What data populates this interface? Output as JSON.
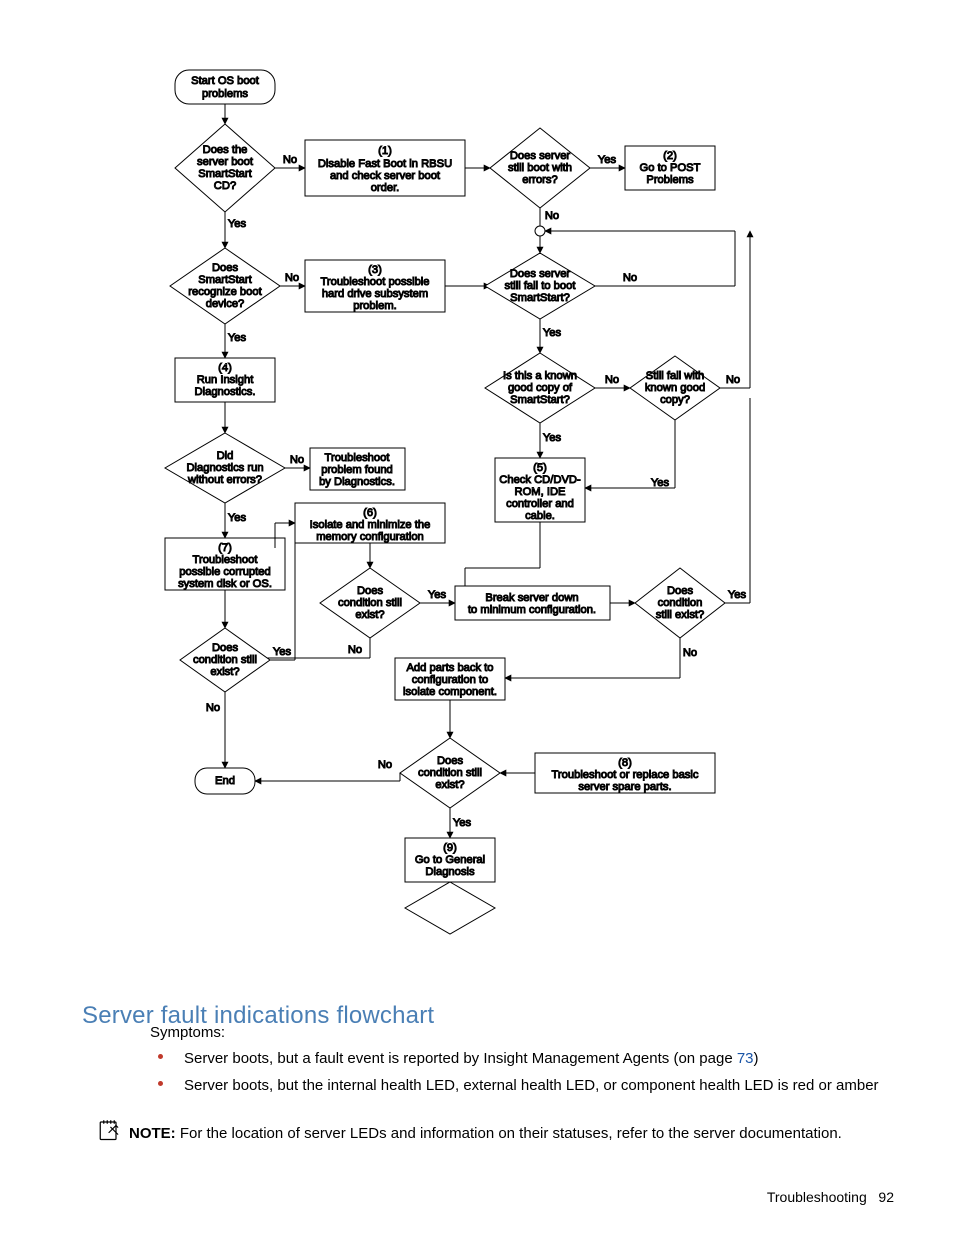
{
  "heading": "Server fault indications flowchart",
  "symptoms_label": "Symptoms:",
  "bullets": [
    {
      "pre": "Server boots, but a fault event is reported by Insight Management Agents (on page ",
      "link": "73",
      "post": ")"
    },
    {
      "pre": "Server boots, but the internal health LED, external health LED, or component health LED is red or amber",
      "link": "",
      "post": ""
    }
  ],
  "note_label": "NOTE:",
  "note_text": "  For the location of server LEDs and information on their statuses, refer to the server documentation.",
  "footer_label": "Troubleshooting",
  "footer_page": "92",
  "flow": {
    "start": [
      "Start OS boot",
      "problems"
    ],
    "d_boot_cd": [
      "Does the",
      "server boot",
      "SmartStart",
      "CD?"
    ],
    "p1": [
      "(1)",
      "Disable Fast Boot in RBSU",
      "and check server boot",
      "order."
    ],
    "d_errors": [
      "Does server",
      "still boot with",
      "errors?"
    ],
    "p2": [
      "(2)",
      "Go to POST",
      "Problems"
    ],
    "d_recognize": [
      "Does",
      "SmartStart",
      "recognize boot",
      "device?"
    ],
    "p3": [
      "(3)",
      "Troubleshoot possible",
      "hard drive subsystem",
      "problem."
    ],
    "d_still_fail": [
      "Does server",
      "still fail to boot",
      "SmartStart?"
    ],
    "p4": [
      "(4)",
      "Run Insight",
      "Diagnostics."
    ],
    "d_known_good": [
      "Is this a known",
      "good copy of",
      "SmartStart?"
    ],
    "d_known_copy": [
      "Still fail with",
      "known good",
      "copy?"
    ],
    "d_diag_err": [
      "Did",
      "Diagnostics run",
      "without errors?"
    ],
    "p_diag_found": [
      "Troubleshoot",
      "problem found",
      "by Diagnostics."
    ],
    "p5": [
      "(5)",
      "Check CD/DVD-",
      "ROM, IDE",
      "controller and",
      "cable."
    ],
    "p6": [
      "(6)",
      "Isolate and minimize the",
      "memory configuration"
    ],
    "p7": [
      "(7)",
      "Troubleshoot",
      "possible corrupted",
      "system disk or OS."
    ],
    "d_cond1": [
      "Does",
      "condition still",
      "exist?"
    ],
    "p_break": [
      "Break server down",
      "to minimum configuration."
    ],
    "d_cond_right": [
      "Does",
      "condition",
      "still exist?"
    ],
    "d_cond_left": [
      "Does",
      "condition still",
      "exist?"
    ],
    "p_addback": [
      "Add parts back to",
      "configuration to",
      "isolate component."
    ],
    "end": [
      "End"
    ],
    "d_cond_bottom": [
      "Does",
      "condition still",
      "exist?"
    ],
    "p8": [
      "(8)",
      "Troubleshoot or replace basic",
      "server spare parts."
    ],
    "p9": [
      "(9)",
      "Go to General",
      "Diagnosis"
    ],
    "labels": {
      "yes": "Yes",
      "no": "No"
    }
  }
}
